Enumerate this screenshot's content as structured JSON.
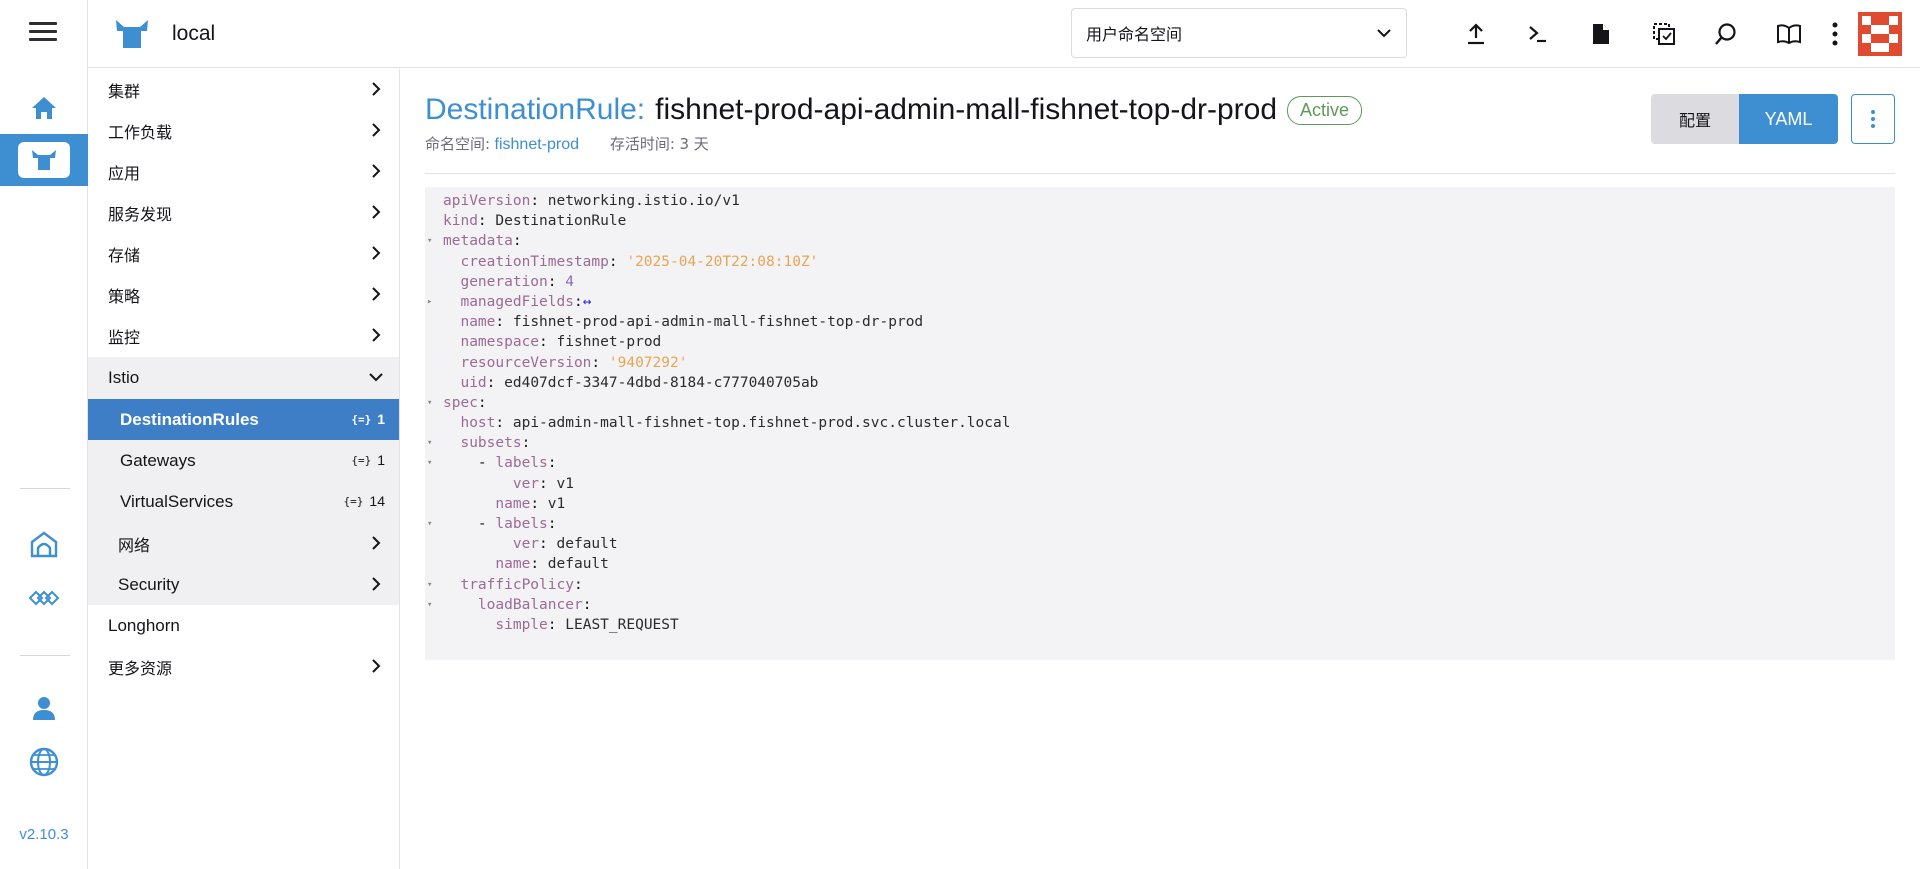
{
  "header": {
    "cluster_name": "local",
    "namespace_filter": "用户命名空间"
  },
  "rail": {
    "version": "v2.10.3"
  },
  "sidenav": {
    "items": [
      {
        "label": "集群",
        "chevron": "right"
      },
      {
        "label": "工作负载",
        "chevron": "right"
      },
      {
        "label": "应用",
        "chevron": "right"
      },
      {
        "label": "服务发现",
        "chevron": "right"
      },
      {
        "label": "存储",
        "chevron": "right"
      },
      {
        "label": "策略",
        "chevron": "right"
      },
      {
        "label": "监控",
        "chevron": "right"
      },
      {
        "label": "Istio",
        "chevron": "down"
      }
    ],
    "istio_sub": [
      {
        "label": "DestinationRules",
        "count": "1"
      },
      {
        "label": "Gateways",
        "count": "1"
      },
      {
        "label": "VirtualServices",
        "count": "14"
      }
    ],
    "istio_more": [
      {
        "label": "网络"
      },
      {
        "label": "Security"
      }
    ],
    "longhorn": "Longhorn",
    "more_resources": "更多资源"
  },
  "main": {
    "kind": "DestinationRule:",
    "resource_name": "fishnet-prod-api-admin-mall-fishnet-top-dr-prod",
    "state": "Active",
    "namespace_label": "命名空间:",
    "namespace_value": "fishnet-prod",
    "age_label": "存活时间:",
    "age_value": "3 天",
    "view_config": "配置",
    "view_yaml": "YAML"
  },
  "yaml": [
    {
      "indent": 0,
      "fold": "",
      "key": "apiVersion",
      "value": "networking.istio.io/v1",
      "vtype": "plain"
    },
    {
      "indent": 0,
      "fold": "",
      "key": "kind",
      "value": "DestinationRule",
      "vtype": "plain"
    },
    {
      "indent": 0,
      "fold": "▾",
      "key": "metadata",
      "value": "",
      "vtype": "plain"
    },
    {
      "indent": 2,
      "fold": "",
      "key": "creationTimestamp",
      "value": "'2025-04-20T22:08:10Z'",
      "vtype": "string"
    },
    {
      "indent": 2,
      "fold": "",
      "key": "generation",
      "value": "4",
      "vtype": "number"
    },
    {
      "indent": 2,
      "fold": "▸",
      "key": "managedFields",
      "value": "↔",
      "vtype": "arrow"
    },
    {
      "indent": 2,
      "fold": "",
      "key": "name",
      "value": "fishnet-prod-api-admin-mall-fishnet-top-dr-prod",
      "vtype": "plain"
    },
    {
      "indent": 2,
      "fold": "",
      "key": "namespace",
      "value": "fishnet-prod",
      "vtype": "plain"
    },
    {
      "indent": 2,
      "fold": "",
      "key": "resourceVersion",
      "value": "'9407292'",
      "vtype": "string"
    },
    {
      "indent": 2,
      "fold": "",
      "key": "uid",
      "value": "ed407dcf-3347-4dbd-8184-c777040705ab",
      "vtype": "plain"
    },
    {
      "indent": 0,
      "fold": "▾",
      "key": "spec",
      "value": "",
      "vtype": "plain"
    },
    {
      "indent": 2,
      "fold": "",
      "key": "host",
      "value": "api-admin-mall-fishnet-top.fishnet-prod.svc.cluster.local",
      "vtype": "plain"
    },
    {
      "indent": 2,
      "fold": "▾",
      "key": "subsets",
      "value": "",
      "vtype": "plain"
    },
    {
      "indent": 4,
      "fold": "▾",
      "key": "labels",
      "value": "",
      "vtype": "plain",
      "dash": true
    },
    {
      "indent": 8,
      "fold": "",
      "key": "ver",
      "value": "v1",
      "vtype": "plain"
    },
    {
      "indent": 6,
      "fold": "",
      "key": "name",
      "value": "v1",
      "vtype": "plain"
    },
    {
      "indent": 4,
      "fold": "▾",
      "key": "labels",
      "value": "",
      "vtype": "plain",
      "dash": true
    },
    {
      "indent": 8,
      "fold": "",
      "key": "ver",
      "value": "default",
      "vtype": "plain"
    },
    {
      "indent": 6,
      "fold": "",
      "key": "name",
      "value": "default",
      "vtype": "plain"
    },
    {
      "indent": 2,
      "fold": "▾",
      "key": "trafficPolicy",
      "value": "",
      "vtype": "plain"
    },
    {
      "indent": 4,
      "fold": "▾",
      "key": "loadBalancer",
      "value": "",
      "vtype": "plain"
    },
    {
      "indent": 6,
      "fold": "",
      "key": "simple",
      "value": "LEAST_REQUEST",
      "vtype": "plain"
    }
  ]
}
